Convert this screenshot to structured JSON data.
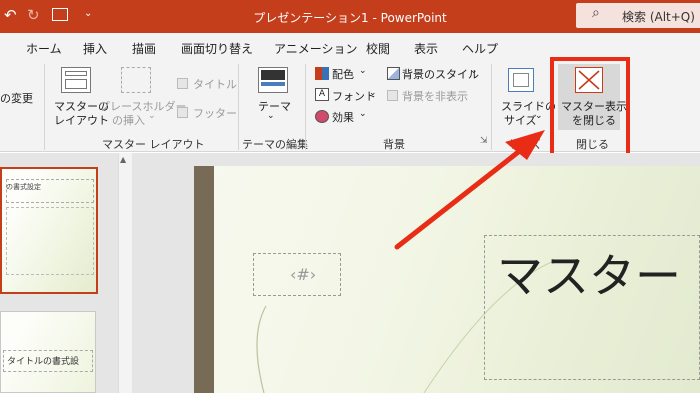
{
  "titlebar": {
    "title": "プレゼンテーション1 - PowerPoint",
    "search_label": "検索 (Alt+Q)"
  },
  "tabs": [
    "ホーム",
    "挿入",
    "描画",
    "画面切り替え",
    "アニメーション",
    "校閲",
    "表示",
    "ヘルプ"
  ],
  "ribbon": {
    "rename_partial": "の変更",
    "master_layout_line1": "マスターの",
    "master_layout_line2": "レイアウト",
    "insert_placeholder_line1": "プレースホルダー",
    "insert_placeholder_line2": "の挿入",
    "title_check": "タイトル",
    "footer_check": "フッター",
    "group_master_layout": "マスター レイアウト",
    "theme_label": "テーマ",
    "group_theme_edit": "テーマの編集",
    "colors_label": "配色",
    "fonts_label": "フォント",
    "effects_label": "効果",
    "bg_styles_label": "背景のスタイル",
    "hide_bg_label": "背景を非表示",
    "group_background": "背景",
    "slide_size_line1": "スライドの",
    "slide_size_line2": "サイズ",
    "group_size": "サイズ",
    "close_master_line1": "マスター表示",
    "close_master_line2": "を閉じる",
    "group_close": "閉じる"
  },
  "thumbnails": {
    "thumb1_text": "の書式設定",
    "thumb2_text": "タイトルの書式設"
  },
  "slide": {
    "number_placeholder": "‹#›",
    "title_text": "マスター"
  },
  "colors": {
    "accent": "#c43e1c",
    "highlight": "#e82c16"
  }
}
